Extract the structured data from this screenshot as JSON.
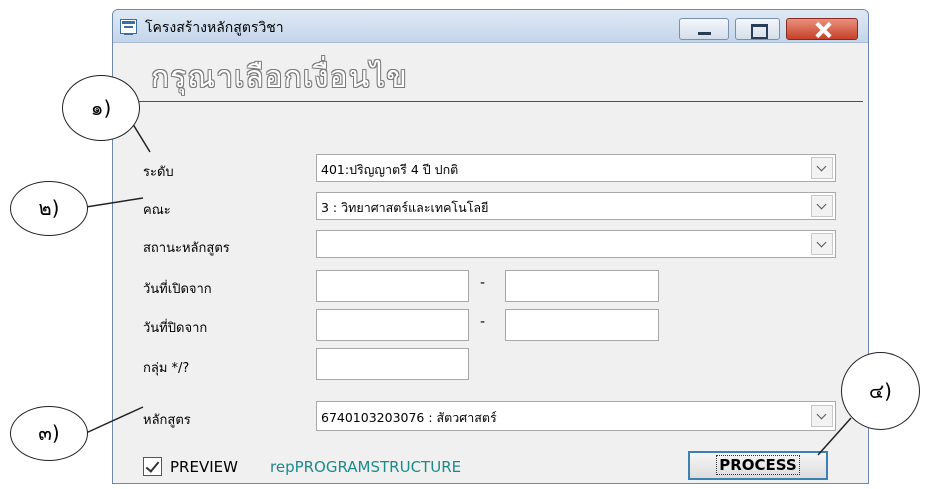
{
  "window": {
    "title": "โครงสร้างหลักสูตรวิชา",
    "header": "กรุณาเลือกเงื่อนไข"
  },
  "form": {
    "level": {
      "label": "ระดับ",
      "value": "401:ปริญญาตรี 4 ปี ปกติ"
    },
    "faculty": {
      "label": "คณะ",
      "value": "3 : วิทยาศาสตร์และเทคโนโลยี"
    },
    "status": {
      "label": "สถานะหลักสูตร",
      "value": ""
    },
    "open_from": {
      "label": "วันที่เปิดจาก",
      "from": "",
      "to": "",
      "separator": "-"
    },
    "close_from": {
      "label": "วันที่ปิดจาก",
      "from": "",
      "to": "",
      "separator": "-"
    },
    "group": {
      "label": "กลุ่ม */?",
      "value": ""
    },
    "program": {
      "label": "หลักสูตร",
      "value": "6740103203076 : สัตวศาสตร์"
    }
  },
  "footer": {
    "preview_label": "PREVIEW",
    "preview_checked": true,
    "report_name": "repPROGRAMSTRUCTURE",
    "process_label": "PROCESS"
  },
  "callouts": [
    "๑)",
    "๒)",
    "๓)",
    "๔)"
  ],
  "icons": [
    "app-form-icon",
    "minimize-icon",
    "maximize-icon",
    "close-icon",
    "chevron-down-icon",
    "checkmark-icon"
  ],
  "colors": {
    "close_button": "#c5412a",
    "report_text": "#1d8a8a",
    "process_border": "#3c7fb1"
  }
}
